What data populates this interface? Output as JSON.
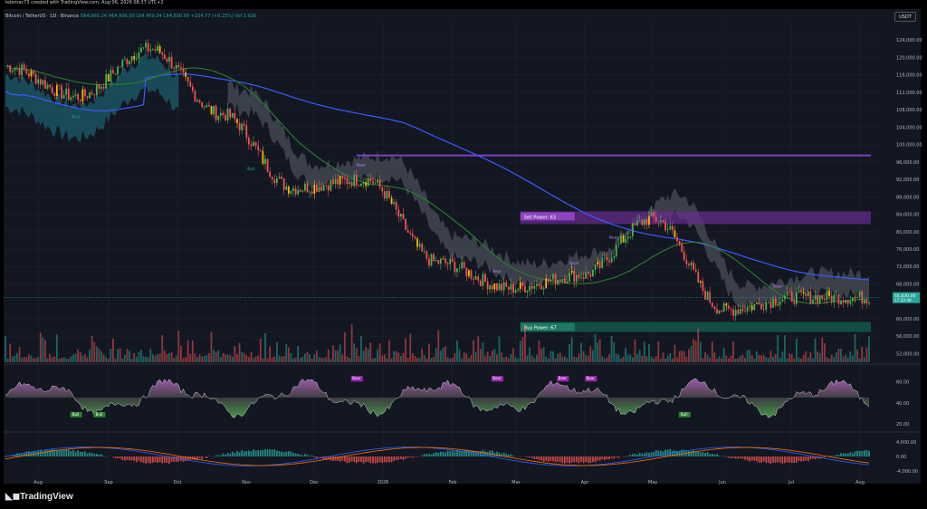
{
  "header": {
    "creator_line": "telemac73 created with TradingView.com, Aug 06, 2026 08:37 UTC+2",
    "symbol_line": "Bitcoin / TetherUS · 1D · Binance",
    "ohlc": "O64,665.24 H64,996.00 L64,459.34 C64,830.00 +164.77 (+0.25%)",
    "extra": "Vol 2.92K",
    "currency": "USDT"
  },
  "price_labels": {
    "last_price": "64,830.00",
    "countdown": "17:22:48"
  },
  "indicator_labels": {
    "sell_power": "Sell Power: 63",
    "buy_power": "Buy Power: 67",
    "bull": "Bull",
    "bear": "Bear"
  },
  "footer": {
    "brand": "TradingView"
  },
  "colors": {
    "background": "#131722",
    "grid": "#1e222d",
    "up": "#4caf50",
    "down": "#ef5350",
    "yellow": "#f0b90b",
    "bear_purple": "#9c27b0",
    "bull_green": "#26a69a",
    "ma_blue": "#3d5afe",
    "ma_green": "#2e7d32",
    "cloud_grey": "#5d606b",
    "band_teal": "#1b5e6a",
    "axis_text": "#b2b5be"
  },
  "chart_data": [
    {
      "type": "line",
      "title": "",
      "ylabel": "",
      "xlabel": "",
      "y_axis_ticks": [
        "124,000.00",
        "120,000.00",
        "116,000.00",
        "112,000.00",
        "108,000.00",
        "104,000.00",
        "100,000.00",
        "96,000.00",
        "92,000.00",
        "88,000.00",
        "84,000.00",
        "80,000.00",
        "76,000.00",
        "72,000.00",
        "68,000.00",
        "60,000.00",
        "56,000.00",
        "52,000.00"
      ],
      "ylim": [
        50000,
        128000
      ],
      "x_axis_ticks": [
        "Aug",
        "Sep",
        "Oct",
        "Nov",
        "Dec",
        "2026",
        "Feb",
        "Mar",
        "Apr",
        "May",
        "Jun",
        "Jul",
        "Aug"
      ],
      "series": [
        {
          "x": [
            "Aug",
            "Sep",
            "Oct",
            "Nov",
            "Dec",
            "2026",
            "Feb",
            "Mar",
            "Apr",
            "May",
            "Jun",
            "Jul",
            "Aug"
          ],
          "values": [
            118000,
            111000,
            122000,
            107000,
            90000,
            92000,
            73000,
            67000,
            70000,
            83000,
            62000,
            65000,
            64830
          ]
        }
      ],
      "horizontal_levels": [
        {
          "label": "",
          "value": 97500
        },
        {
          "label": "Sell Power: 63",
          "value": 83200
        },
        {
          "label": "Buy Power: 67",
          "value": 58000
        }
      ],
      "grid": true
    },
    {
      "type": "area",
      "title": "",
      "y_axis_ticks": [
        "60.00",
        "40.00",
        "20.00"
      ],
      "ylim": [
        15,
        75
      ]
    },
    {
      "type": "bar",
      "title": "",
      "y_axis_ticks": [
        "4,000.00",
        "0.00",
        "-4,000.00"
      ],
      "ylim": [
        -6000,
        6000
      ]
    }
  ]
}
